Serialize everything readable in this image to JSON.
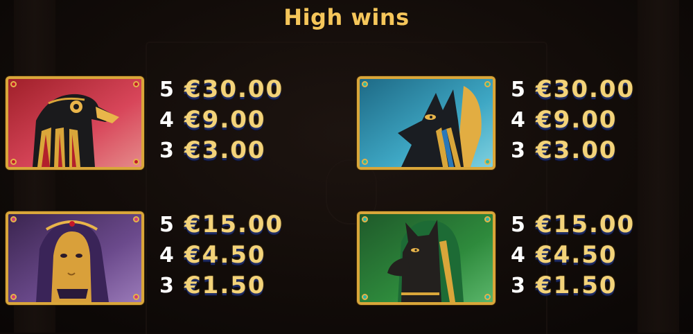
{
  "title": "High wins",
  "symbols": [
    {
      "name": "Horus",
      "icon": "horus-falcon-icon",
      "gem_color": "#c4182a",
      "pays": [
        {
          "count": "5",
          "amount": "€30.00"
        },
        {
          "count": "4",
          "amount": "€9.00"
        },
        {
          "count": "3",
          "amount": "€3.00"
        }
      ]
    },
    {
      "name": "Anubis",
      "icon": "anubis-jackal-icon",
      "gem_color": "#2bb8a8",
      "pays": [
        {
          "count": "5",
          "amount": "€30.00"
        },
        {
          "count": "4",
          "amount": "€9.00"
        },
        {
          "count": "3",
          "amount": "€3.00"
        }
      ]
    },
    {
      "name": "Pharaoh",
      "icon": "pharaoh-mask-icon",
      "gem_color": "#d23a7a",
      "pays": [
        {
          "count": "5",
          "amount": "€15.00"
        },
        {
          "count": "4",
          "amount": "€4.50"
        },
        {
          "count": "3",
          "amount": "€1.50"
        }
      ]
    },
    {
      "name": "Bastet",
      "icon": "bastet-cat-icon",
      "gem_color": "#2bb8a8",
      "pays": [
        {
          "count": "5",
          "amount": "€15.00"
        },
        {
          "count": "4",
          "amount": "€4.50"
        },
        {
          "count": "3",
          "amount": "€1.50"
        }
      ]
    }
  ]
}
